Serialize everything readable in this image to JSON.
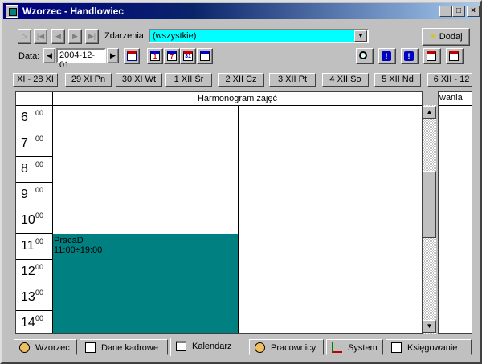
{
  "window": {
    "title": "Wzorzec - Handlowiec"
  },
  "titlebar_buttons": {
    "minimize": "_",
    "maximize": "□",
    "close": "×"
  },
  "toolbar": {
    "events_label": "Zdarzenia:",
    "events_value": "(wszystkie)",
    "add_label": "Dodaj",
    "date_label": "Data:",
    "date_value": "2004-12-01",
    "nav_buttons": [
      "first",
      "prev",
      "next",
      "last"
    ],
    "view_icons": [
      "calendar-grid-icon",
      "view-day-icon",
      "view-week-icon",
      "view-month-icon",
      "view-list-icon"
    ],
    "action_icons": [
      "search-icon",
      "alert-info-icon",
      "alert-add-icon",
      "schedule-icon",
      "calendar-red-icon"
    ]
  },
  "day_tabs": [
    "XI - 28 XI",
    "29 XI Pn",
    "30 XI Wt",
    "1 XII Śr",
    "2 XII Cz",
    "3 XII Pt",
    "4 XII So",
    "5 XII Nd",
    "6 XII - 12"
  ],
  "schedule": {
    "header_title": "Harmonogram zajęć",
    "hours": [
      {
        "h": "6",
        "m": "00"
      },
      {
        "h": "7",
        "m": "00"
      },
      {
        "h": "8",
        "m": "00"
      },
      {
        "h": "9",
        "m": "00"
      },
      {
        "h": "10",
        "m": "00"
      },
      {
        "h": "11",
        "m": "00"
      },
      {
        "h": "12",
        "m": "00"
      },
      {
        "h": "13",
        "m": "00"
      },
      {
        "h": "14",
        "m": "00"
      }
    ],
    "event": {
      "title": "PracaD",
      "time": "11:00÷19:00",
      "color": "#008080"
    }
  },
  "right_panel": {
    "header": "wania"
  },
  "bottom_tabs": [
    {
      "label": "Wzorzec",
      "icon": "people-icon"
    },
    {
      "label": "Dane kadrowe",
      "icon": "document-icon"
    },
    {
      "label": "Kalendarz",
      "icon": "calendar-icon",
      "active": true
    },
    {
      "label": "Pracownicy",
      "icon": "worker-icon"
    },
    {
      "label": "System",
      "icon": "tree-icon"
    },
    {
      "label": "Księgowanie",
      "icon": "ledger-icon"
    }
  ],
  "colors": {
    "title_start": "#000080",
    "combo_bg": "#00ffff",
    "event_bg": "#008080",
    "face": "#c0c0c0"
  }
}
